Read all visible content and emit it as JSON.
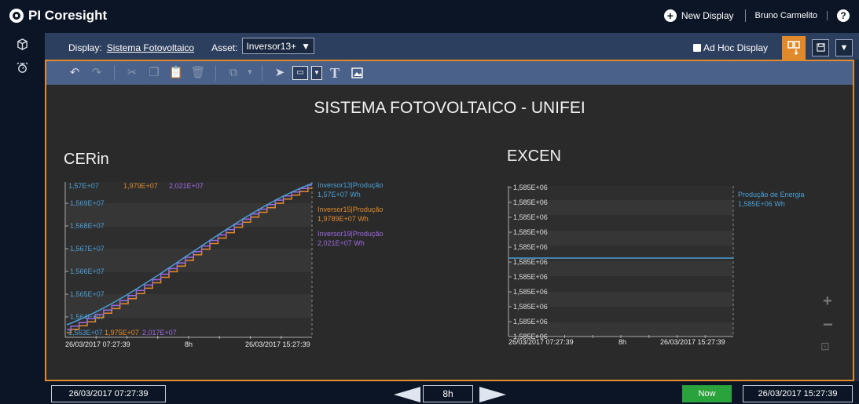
{
  "app": {
    "brand_prefix": "PI ",
    "brand_name": "Coresight"
  },
  "top": {
    "new_display": "New Display",
    "user": "Bruno Carmelito",
    "help": "?"
  },
  "dispbar": {
    "display_label": "Display:",
    "display_name": "Sistema Fotovoltaico",
    "asset_label": "Asset:",
    "asset_value": "Inversor13+",
    "adhoc_label": "Ad Hoc Display"
  },
  "display": {
    "title": "SISTEMA FOTOVOLTAICO - UNIFEI",
    "left_title": "CERin",
    "right_title": "EXCEN"
  },
  "trend_left": {
    "top_values": [
      "1,57E+07",
      "1,979E+07",
      "2,021E+07"
    ],
    "bottom_values": [
      "1,563E+07",
      "1,975E+07",
      "2,017E+07"
    ],
    "y_ticks": [
      "1,569E+07",
      "1,568E+07",
      "1,567E+07",
      "1,566E+07",
      "1,565E+07",
      "1,564E+07"
    ],
    "x_start": "26/03/2017 07:27:39",
    "x_span": "8h",
    "x_end": "26/03/2017 15:27:39",
    "legend": [
      {
        "name": "Inversor13|Produção",
        "value": "1,57E+07 Wh",
        "color": "#4a9fd6"
      },
      {
        "name": "Inversor15|Produção",
        "value": "1,9789E+07 Wh",
        "color": "#e08a2c"
      },
      {
        "name": "Inversor19|Produção",
        "value": "2,021E+07 Wh",
        "color": "#9b6ae0"
      }
    ]
  },
  "trend_right": {
    "y_ticks": [
      "1,585E+06",
      "1,585E+06",
      "1,585E+06",
      "1,585E+06",
      "1,585E+06",
      "1,585E+06",
      "1,585E+06",
      "1,585E+06",
      "1,585E+06",
      "1,585E+06",
      "1,585E+06"
    ],
    "x_start": "26/03/2017 07:27:39",
    "x_span": "8h",
    "x_end": "26/03/2017 15:27:39",
    "legend": [
      {
        "name": "Produção de Energia",
        "value": "1,585E+06 Wh",
        "color": "#4a9fd6"
      }
    ]
  },
  "bottom": {
    "start_time": "26/03/2017 07:27:39",
    "duration": "8h",
    "now_label": "Now",
    "end_time": "26/03/2017 15:27:39"
  },
  "colors": {
    "accent": "#e08a2c",
    "now": "#2ba33c",
    "series1": "#4a9fd6",
    "series2": "#e08a2c",
    "series3": "#9b6ae0"
  }
}
